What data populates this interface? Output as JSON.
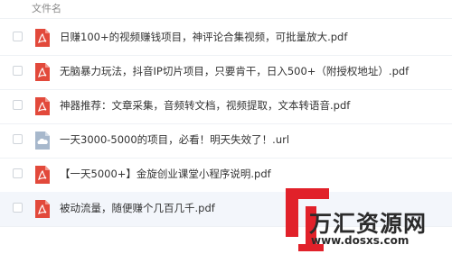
{
  "header": {
    "column_label": "文件名"
  },
  "files": [
    {
      "name": "日赚100+的视频赚钱项目，神评论合集视频，可批量放大.pdf",
      "icon": "pdf-icon"
    },
    {
      "name": "无脑暴力玩法，抖音IP切片项目，只要肯干，日入500+（附授权地址）.pdf",
      "icon": "pdf-icon"
    },
    {
      "name": "神器推荐：文章采集，音频转文档，视频提取，文本转语音.pdf",
      "icon": "pdf-icon"
    },
    {
      "name": "一天3000-5000的项目，必看！明天失效了！.url",
      "icon": "cloud-link-icon"
    },
    {
      "name": "【一天5000+】金旋创业课堂小程序说明.pdf",
      "icon": "pdf-icon"
    },
    {
      "name": "被动流量，随便赚个几百几千.pdf",
      "icon": "pdf-icon"
    }
  ],
  "watermark": {
    "name": "万汇资源网",
    "url": "www.dosxs.com"
  },
  "colors": {
    "pdf_red": "#e2493b",
    "link_icon": "#a7b8cc",
    "brand_red": "#e1212a",
    "row_highlight": "#f3f6fb"
  }
}
